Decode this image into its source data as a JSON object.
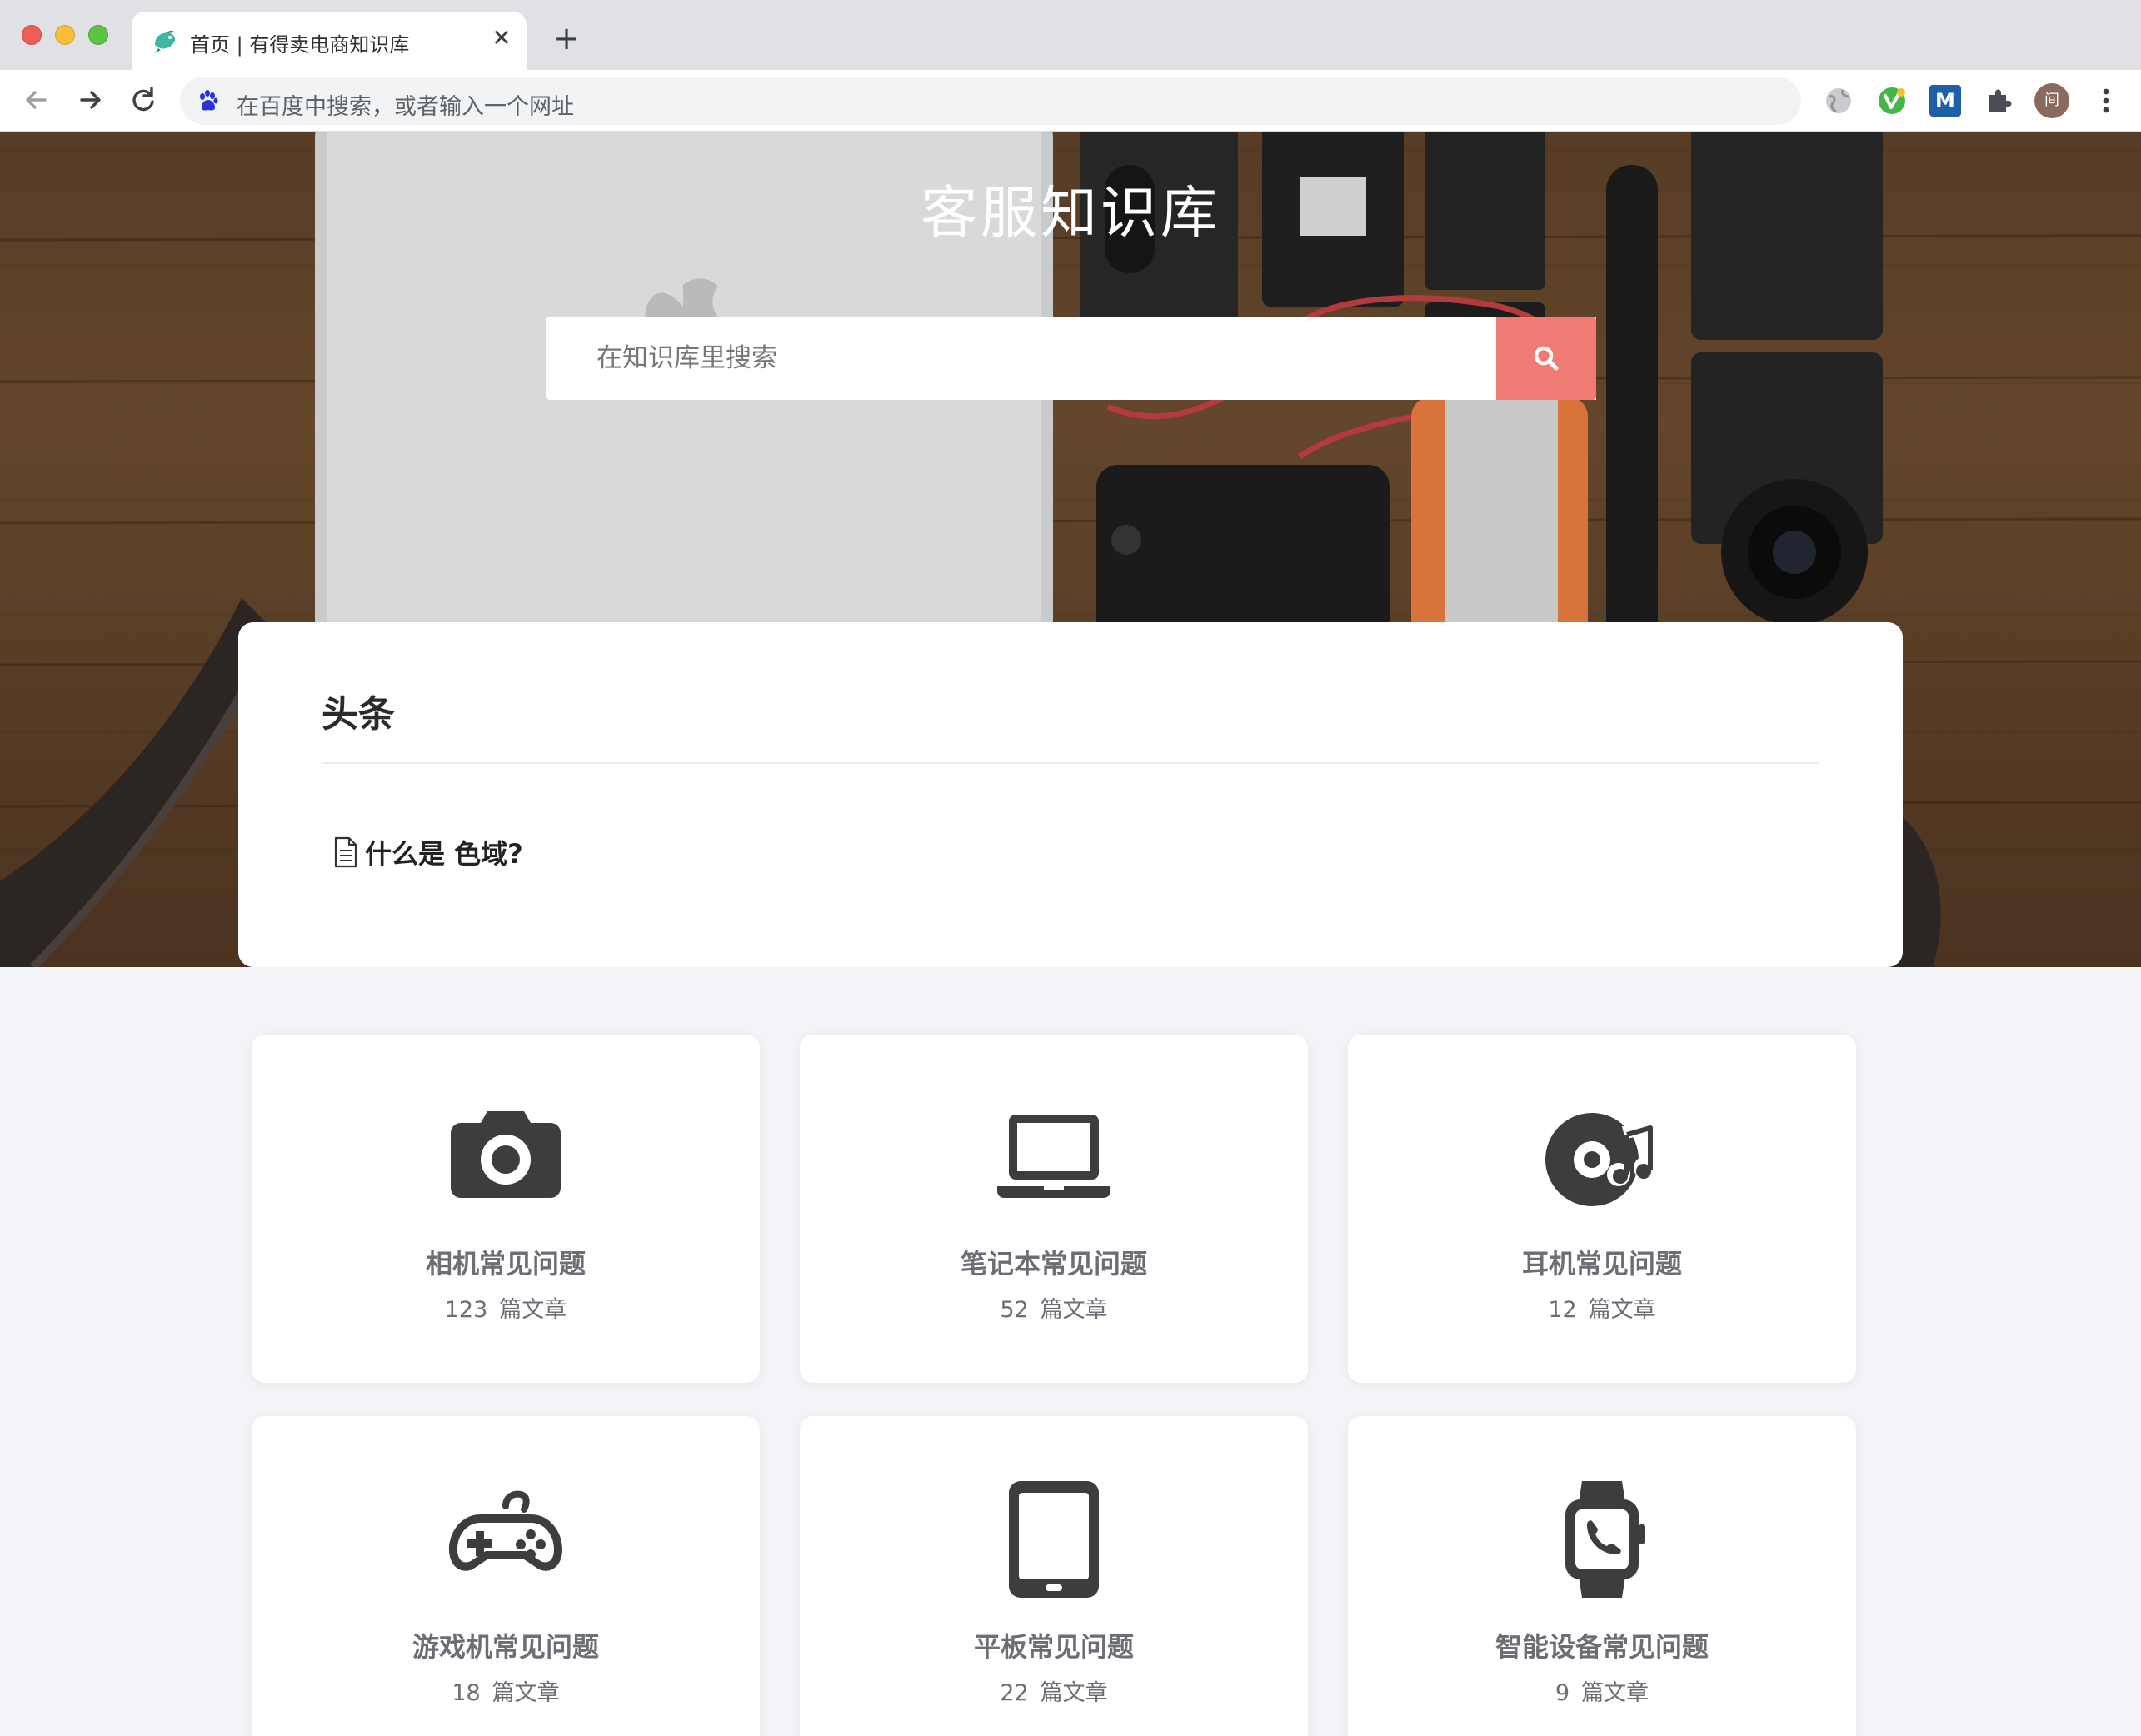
{
  "browser": {
    "tab_title": "首页 | 有得卖电商知识库",
    "tab_close": "✕",
    "new_tab": "+",
    "omnibox_placeholder": "在百度中搜索，或者输入一个网址",
    "avatar_letter": "间",
    "ext_m_label": "M"
  },
  "hero": {
    "title": "客服知识库",
    "search_placeholder": "在知识库里搜索"
  },
  "headlines": {
    "title": "头条",
    "items": [
      {
        "text": "什么是 色域?"
      }
    ]
  },
  "categories": [
    {
      "name": "相机常见问题",
      "count": "123",
      "unit": "篇文章",
      "icon": "camera-icon"
    },
    {
      "name": "笔记本常见问题",
      "count": "52",
      "unit": "篇文章",
      "icon": "laptop-icon"
    },
    {
      "name": "耳机常见问题",
      "count": "12",
      "unit": "篇文章",
      "icon": "music-disc-icon"
    },
    {
      "name": "游戏机常见问题",
      "count": "18",
      "unit": "篇文章",
      "icon": "gamepad-icon"
    },
    {
      "name": "平板常见问题",
      "count": "22",
      "unit": "篇文章",
      "icon": "tablet-icon"
    },
    {
      "name": "智能设备常见问题",
      "count": "9",
      "unit": "篇文章",
      "icon": "smartwatch-icon"
    }
  ],
  "colors": {
    "accent": "#f07a74",
    "icon": "#3d3d3f",
    "card_text": "#6b6e75",
    "page_bg": "#f3f4f7"
  }
}
